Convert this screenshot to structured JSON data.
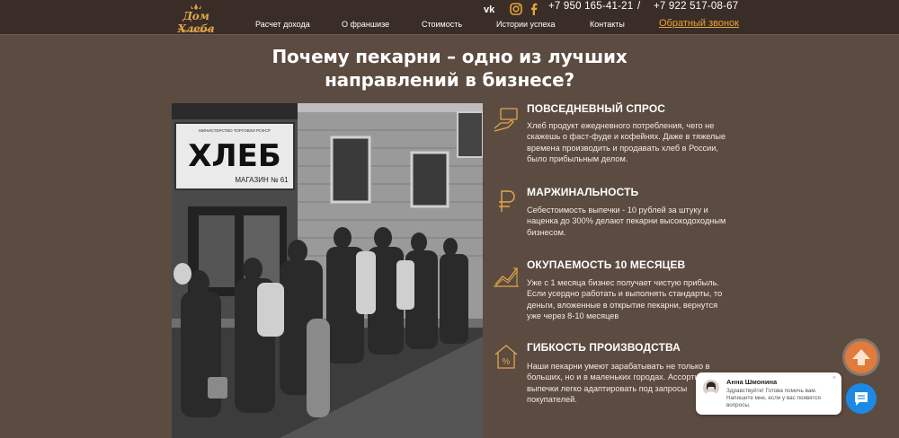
{
  "header": {
    "logo_text": "Дом Хлеба",
    "nav": [
      "Расчет дохода",
      "О франшизе",
      "Стоимость",
      "Истории успеха",
      "Контакты"
    ],
    "social_icons": [
      "vk-icon",
      "instagram-icon",
      "facebook-icon"
    ],
    "phone1": "+7 950 165-41-21",
    "separator": "/",
    "phone2": "+7 922 517-08-67",
    "callback": "Обратный звонок"
  },
  "headline": "Почему пекарни – одно из лучших направлений в бизнесе?",
  "photo": {
    "sign_main": "ХЛЕБ",
    "sign_top": "МИНИСТЕРСТВО ТОРГОВЛИ РСФСР",
    "sign_sub": "МАГАЗИН № 61"
  },
  "features": [
    {
      "icon": "hand-card-icon",
      "title": "ПОВСЕДНЕВНЫЙ СПРОС",
      "text": "Хлеб продукт ежедневного потребления, чего не скажешь о фаст-фуде и кофейнях. Даже в тяжелые времена производить и продавать хлеб в России, было прибыльным делом."
    },
    {
      "icon": "ruble-icon",
      "title": "МАРЖИНАЛЬНОСТЬ",
      "text": "Себестоимость выпечки - 10 рублей за штуку и наценка до 300% делают пекарни высокодоходным бизнесом."
    },
    {
      "icon": "growth-chart-icon",
      "title": "ОКУПАЕМОСТЬ 10 МЕСЯЦЕВ",
      "text": "Уже с 1 месяца бизнес получает чистую прибыль. Если усердно работать и выполнять стандарты, то деньги, вложенные в открытие пекарни, вернутся уже через 8-10 месяцев"
    },
    {
      "icon": "percent-house-icon",
      "title": "ГИБКОСТЬ ПРОИЗВОДСТВА",
      "text": "Наши пекарни умеют зарабатывать не только в больших, но и в маленьких городах. Ассортимент выпечки легко адаптировать под запросы покупателей."
    }
  ],
  "chat": {
    "name": "Анна Шмонина",
    "message": "Здравствуйте! Готова помочь вам. Напишите мне, если у вас появятся вопросы.",
    "close": "×"
  },
  "colors": {
    "background": "#5c4b40",
    "header": "#3a2d27",
    "accent": "#e8a33c",
    "chat_button": "#1e88e5"
  }
}
